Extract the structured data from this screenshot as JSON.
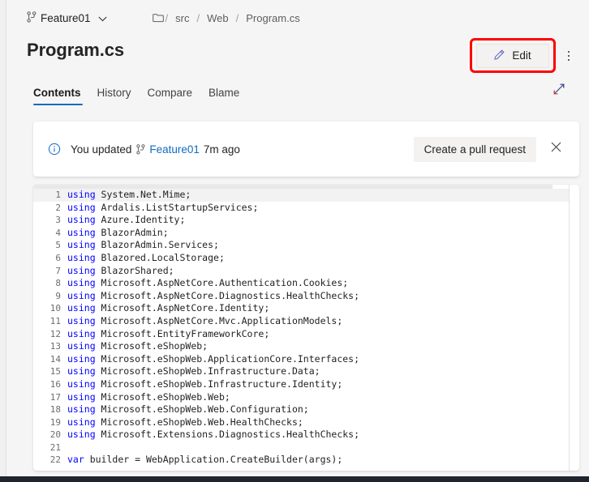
{
  "breadcrumb": {
    "branch_icon": "git-branch-icon",
    "branch_name": "Feature01",
    "chevron": "⌄",
    "folder_icon": "folder-icon",
    "segments": [
      "src",
      "Web",
      "Program.cs"
    ],
    "separator": "/"
  },
  "header": {
    "title": "Program.cs",
    "edit_label": "Edit",
    "edit_icon": "pencil-icon",
    "more_icon": "more-vertical-icon",
    "highlight_color": "#ff0000"
  },
  "tabs": [
    {
      "label": "Contents",
      "active": true
    },
    {
      "label": "History",
      "active": false
    },
    {
      "label": "Compare",
      "active": false
    },
    {
      "label": "Blame",
      "active": false
    }
  ],
  "expand": {
    "icon": "expand-diagonal-icon"
  },
  "notice": {
    "info_icon": "info-circle-icon",
    "prefix": "You updated",
    "branch_icon": "git-branch-icon",
    "branch_link": "Feature01",
    "time": "7m ago",
    "button_label": "Create a pull request",
    "close_icon": "close-icon"
  },
  "editor": {
    "language": "csharp",
    "current_line": 1,
    "lines": [
      {
        "n": 1,
        "kw": "using",
        "rest": " System.Net.Mime;"
      },
      {
        "n": 2,
        "kw": "using",
        "rest": " Ardalis.ListStartupServices;"
      },
      {
        "n": 3,
        "kw": "using",
        "rest": " Azure.Identity;"
      },
      {
        "n": 4,
        "kw": "using",
        "rest": " BlazorAdmin;"
      },
      {
        "n": 5,
        "kw": "using",
        "rest": " BlazorAdmin.Services;"
      },
      {
        "n": 6,
        "kw": "using",
        "rest": " Blazored.LocalStorage;"
      },
      {
        "n": 7,
        "kw": "using",
        "rest": " BlazorShared;"
      },
      {
        "n": 8,
        "kw": "using",
        "rest": " Microsoft.AspNetCore.Authentication.Cookies;"
      },
      {
        "n": 9,
        "kw": "using",
        "rest": " Microsoft.AspNetCore.Diagnostics.HealthChecks;"
      },
      {
        "n": 10,
        "kw": "using",
        "rest": " Microsoft.AspNetCore.Identity;"
      },
      {
        "n": 11,
        "kw": "using",
        "rest": " Microsoft.AspNetCore.Mvc.ApplicationModels;"
      },
      {
        "n": 12,
        "kw": "using",
        "rest": " Microsoft.EntityFrameworkCore;"
      },
      {
        "n": 13,
        "kw": "using",
        "rest": " Microsoft.eShopWeb;"
      },
      {
        "n": 14,
        "kw": "using",
        "rest": " Microsoft.eShopWeb.ApplicationCore.Interfaces;"
      },
      {
        "n": 15,
        "kw": "using",
        "rest": " Microsoft.eShopWeb.Infrastructure.Data;"
      },
      {
        "n": 16,
        "kw": "using",
        "rest": " Microsoft.eShopWeb.Infrastructure.Identity;"
      },
      {
        "n": 17,
        "kw": "using",
        "rest": " Microsoft.eShopWeb.Web;"
      },
      {
        "n": 18,
        "kw": "using",
        "rest": " Microsoft.eShopWeb.Web.Configuration;"
      },
      {
        "n": 19,
        "kw": "using",
        "rest": " Microsoft.eShopWeb.Web.HealthChecks;"
      },
      {
        "n": 20,
        "kw": "using",
        "rest": " Microsoft.Extensions.Diagnostics.HealthChecks;"
      },
      {
        "n": 21,
        "kw": "",
        "rest": ""
      },
      {
        "n": 22,
        "kw": "var",
        "rest": " builder = WebApplication.CreateBuilder(args);"
      }
    ]
  },
  "colors": {
    "accent": "#0f6cbd",
    "link": "#0f6cbd",
    "keyword": "#0000ff",
    "page_bg": "#f5f5f5",
    "card_bg": "#ffffff",
    "bottom_band": "#1f2430"
  }
}
